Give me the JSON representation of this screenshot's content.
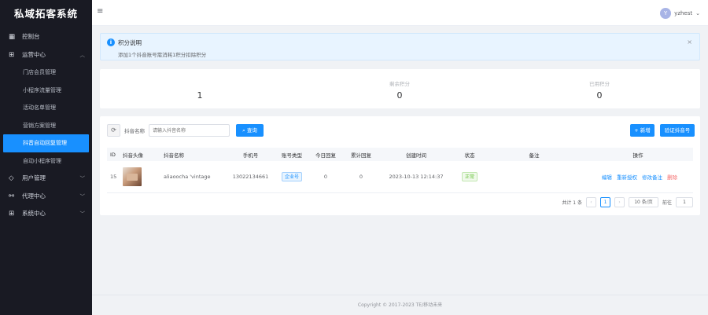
{
  "app": {
    "title": "私域拓客系统"
  },
  "sidebar": {
    "items": [
      {
        "label": "控制台",
        "icon": "dashboard-icon",
        "glyph": "▦"
      },
      {
        "label": "运营中心",
        "icon": "grid-icon",
        "glyph": "⊞",
        "expanded": true,
        "children": [
          {
            "label": "门店会员管理"
          },
          {
            "label": "小程序流量管理"
          },
          {
            "label": "活动名单管理"
          },
          {
            "label": "营销方案管理"
          },
          {
            "label": "抖音自动回复管理",
            "active": true
          },
          {
            "label": "自动小程序管理"
          }
        ]
      },
      {
        "label": "用户管理",
        "icon": "diamond-icon",
        "glyph": "◇"
      },
      {
        "label": "代理中心",
        "icon": "share-icon",
        "glyph": "⚯"
      },
      {
        "label": "系统中心",
        "icon": "settings-grid-icon",
        "glyph": "⊞"
      }
    ]
  },
  "topbar": {
    "menu_glyph": "≡",
    "user": {
      "initial": "Y",
      "name": "yzhest",
      "caret": "⌄"
    }
  },
  "notice": {
    "title": "积分说明",
    "desc": "添加1个抖音账号需消耗1积分扣除积分",
    "close": "×"
  },
  "stats": [
    {
      "label": "",
      "value": "1"
    },
    {
      "label": "剩余积分",
      "value": "0"
    },
    {
      "label": "已用积分",
      "value": "0"
    }
  ],
  "filter": {
    "refresh_glyph": "⟳",
    "label": "抖音名称",
    "placeholder": "请输入抖音名称",
    "search_label": "查询",
    "search_glyph": "⌕",
    "add_label": "新增",
    "add_glyph": "+",
    "verify_label": "验证抖音号"
  },
  "table": {
    "columns": [
      "ID",
      "抖音头像",
      "抖音名称",
      "手机号",
      "账号类型",
      "今日回复",
      "累计回复",
      "创建时间",
      "状态",
      "备注",
      "操作"
    ],
    "rows": [
      {
        "id": "15",
        "avatar": "shop-thumbnail",
        "name": "aliaoocha 'vintage",
        "phone": "13022134661",
        "type": "企业号",
        "today": "0",
        "total": "0",
        "created": "2023-10-13 12:14:37",
        "status": "正常",
        "remark": "",
        "ops": [
          "编辑",
          "重新授权",
          "修改备注",
          "删除"
        ]
      }
    ]
  },
  "pagination": {
    "total_text": "共计 1 条",
    "prev": "‹",
    "current": "1",
    "next": "›",
    "page_size": "10 条/页",
    "goto_label": "前往",
    "goto_value": "1"
  },
  "footer": {
    "text": "Copyright © 2017-2023 TE/移动未来"
  }
}
